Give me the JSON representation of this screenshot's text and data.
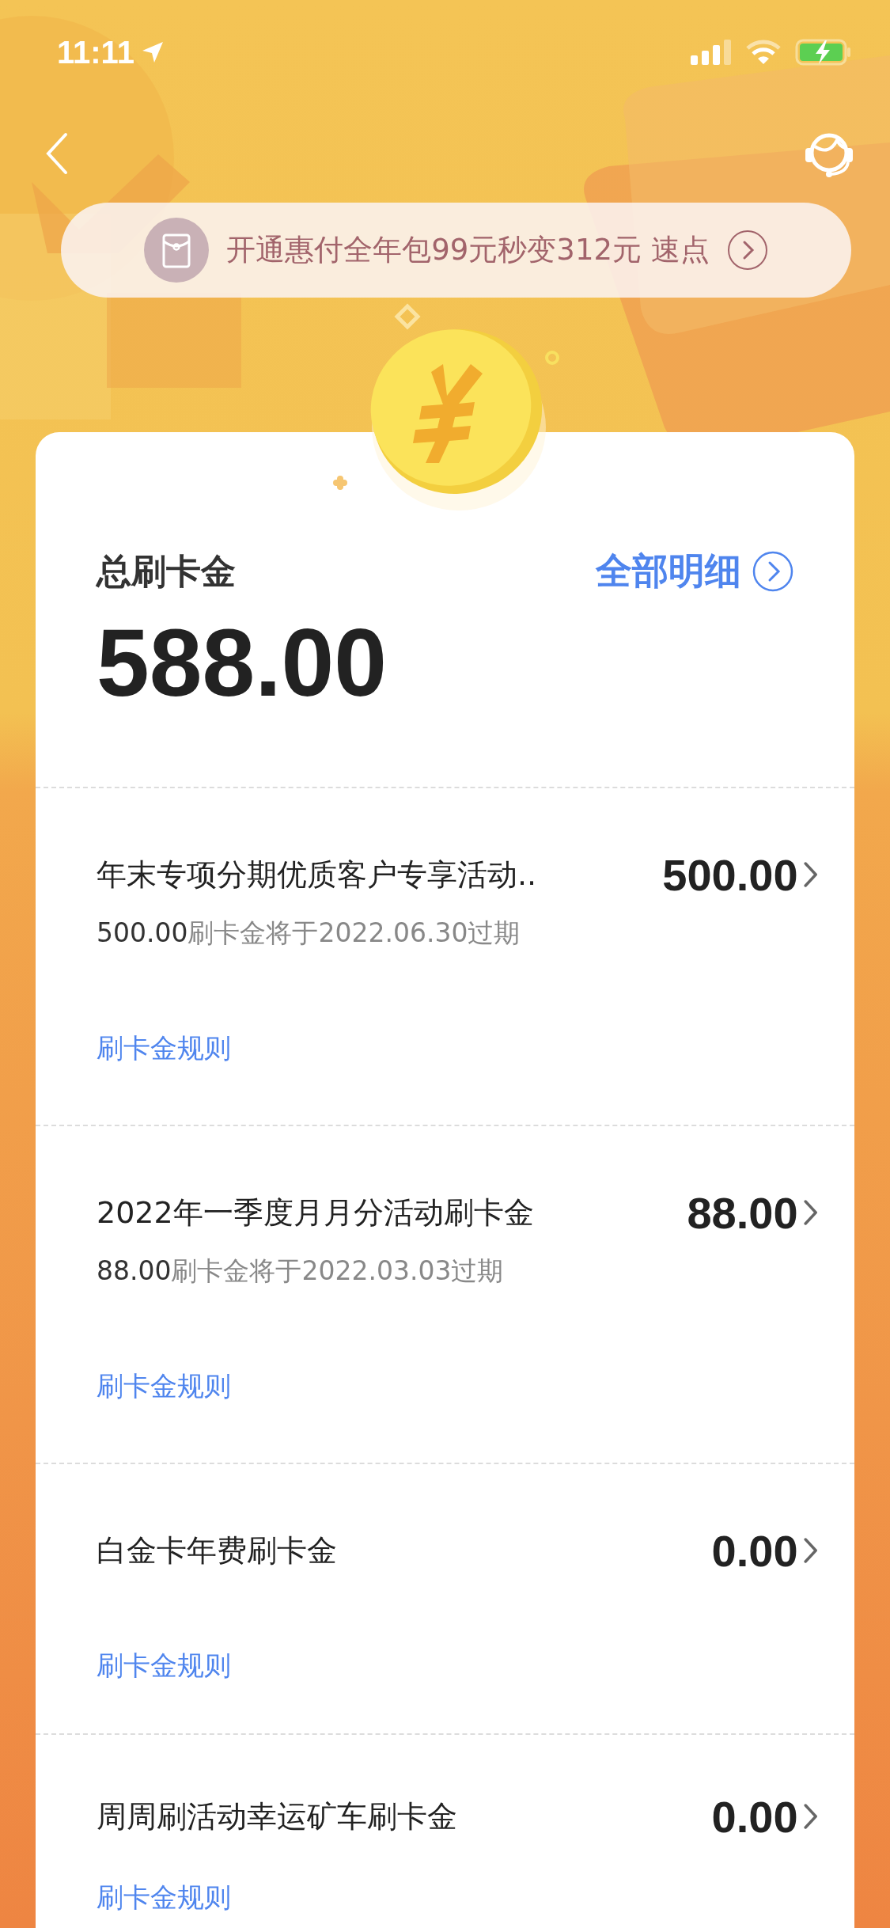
{
  "status_bar": {
    "time": "11:11"
  },
  "promo_banner": {
    "text": "开通惠付全年包99元秒变312元 速点"
  },
  "summary": {
    "label": "总刷卡金",
    "details_link": "全部明细",
    "total": "588.00"
  },
  "items": [
    {
      "title": "年末专项分期优质客户专享活动..",
      "amount": "500.00",
      "expiry_amount": "500.00",
      "expiry_text": "刷卡金将于2022.06.30过期",
      "rules_link": "刷卡金规则"
    },
    {
      "title": "2022年一季度月月分活动刷卡金",
      "amount": "88.00",
      "expiry_amount": "88.00",
      "expiry_text": "刷卡金将于2022.03.03过期",
      "rules_link": "刷卡金规则"
    },
    {
      "title": "白金卡年费刷卡金",
      "amount": "0.00",
      "rules_link": "刷卡金规则"
    },
    {
      "title": "周周刷活动幸运矿车刷卡金",
      "amount": "0.00",
      "rules_link": "刷卡金规则"
    }
  ]
}
